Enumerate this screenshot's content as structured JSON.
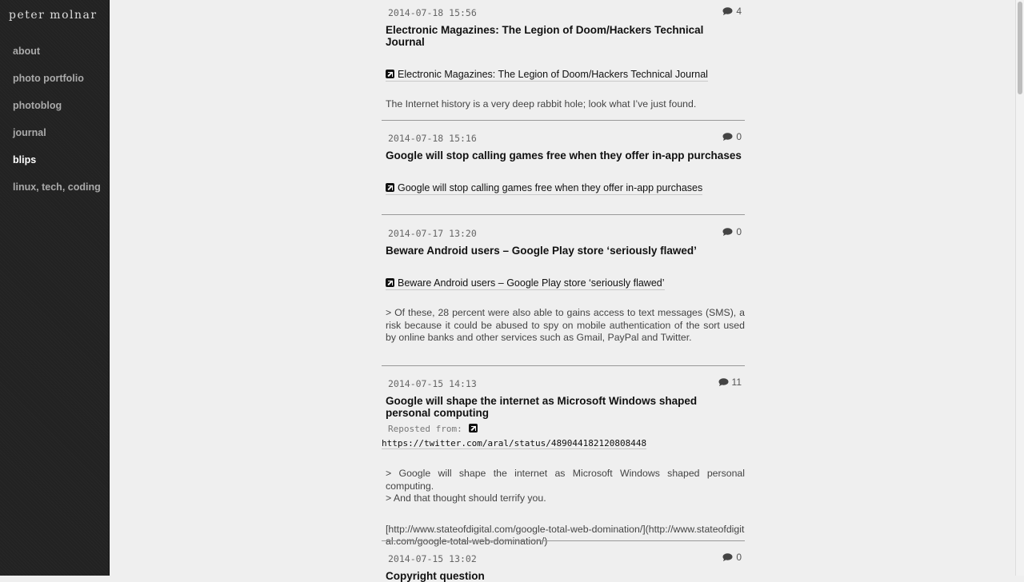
{
  "site": {
    "brand": "peter molnar",
    "nav": [
      {
        "label": "about"
      },
      {
        "label": "photo portfolio"
      },
      {
        "label": "photoblog"
      },
      {
        "label": "journal"
      },
      {
        "label": "blips"
      },
      {
        "label": "linux, tech, coding"
      }
    ],
    "active_nav": "blips"
  },
  "posts": [
    {
      "date": "2014-07-18 15:56",
      "comments": "4",
      "title": "Electronic Magazines: The Legion of Doom/Hackers Technical Journal",
      "link_text": "Electronic Magazines: The Legion of Doom/Hackers Technical Journal",
      "body": [
        "The Internet history is a very deep rabbit hole; look what I’ve just found."
      ]
    },
    {
      "date": "2014-07-18 15:16",
      "comments": "0",
      "title": "Google will stop calling games free when they offer in-app purchases",
      "link_text": "Google will stop calling games free when they offer in-app purchases",
      "body": []
    },
    {
      "date": "2014-07-17 13:20",
      "comments": "0",
      "title": "Beware Android users – Google Play store ‘seriously flawed’",
      "link_text": "Beware Android users – Google Play store ‘seriously flawed’",
      "body": [
        "> Of these, 28 percent were also able to gains access to text messages (SMS), a risk because it could be abused to spy on mobile authentication of the sort used by online banks and other services such as Gmail, PayPal and Twitter."
      ]
    },
    {
      "date": "2014-07-15 14:13",
      "comments": "11",
      "title": "Google will shape the internet as Microsoft Windows shaped personal computing",
      "repost_label": "Reposted from:",
      "repost_url": "https://twitter.com/aral/status/489044182120808448",
      "body": [
        "> Google will shape the internet as Microsoft Windows shaped personal computing.",
        "> And that thought should terrify you.",
        "[http://www.stateofdigital.com/google-total-web-domination/](http://www.stateofdigital.com/google-total-web-domination/)"
      ]
    },
    {
      "date": "2014-07-15 13:02",
      "comments": "0",
      "title": "Copyright question"
    }
  ]
}
